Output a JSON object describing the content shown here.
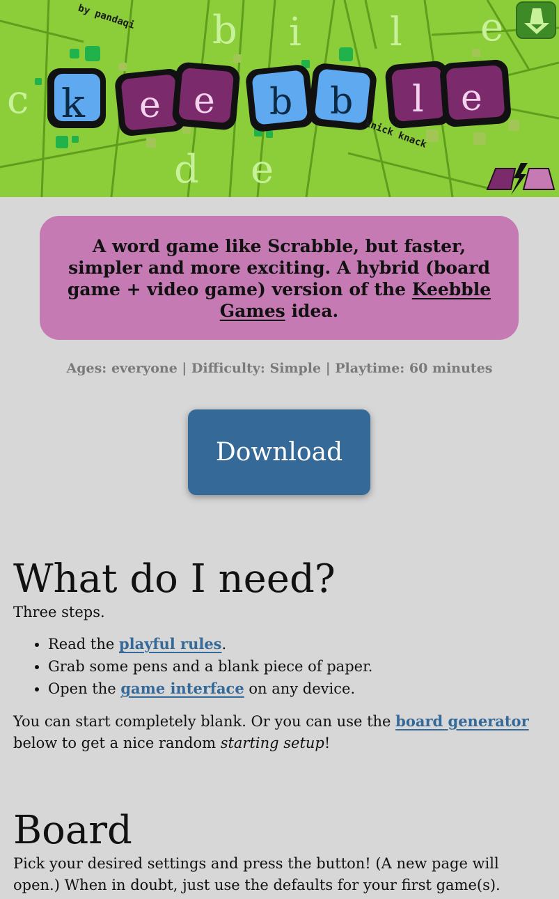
{
  "header": {
    "logo_letters": [
      "k",
      "e",
      "e",
      "b",
      "b",
      "l",
      "e"
    ],
    "byline": "by pandaqi",
    "series": "knick knack",
    "background_letters": [
      "c",
      "b",
      "i",
      "l",
      "e",
      "d",
      "e"
    ],
    "home_icon": "home-cone-icon",
    "brand_icon": "pandaqi-logo-icon",
    "colors": {
      "green": "#8ccd3a",
      "blue_tile": "#5ea9ef",
      "purple_tile": "#7b2a6b"
    }
  },
  "intro": {
    "text_before": "A word game like Scrabble, but faster, simpler and more exciting. A hybrid (board game + video game) version of the ",
    "link": "Keebble Games",
    "text_after": " idea."
  },
  "meta": "Ages: everyone | Difficulty: Simple | Playtime: 60 minutes",
  "download_label": "Download",
  "section_need": {
    "title": "What do I need?",
    "subtitle": "Three steps.",
    "items": [
      {
        "before": "Read the ",
        "link": "playful rules",
        "after": "."
      },
      {
        "before": "Grab some pens and a blank piece of paper.",
        "link": "",
        "after": ""
      },
      {
        "before": "Open the ",
        "link": "game interface",
        "after": " on any device."
      }
    ],
    "para_before": "You can start completely blank. Or you can use the ",
    "para_link": "board generator",
    "para_mid": " below to get a nice random ",
    "para_em": "starting setup",
    "para_after": "!"
  },
  "section_board": {
    "title": "Board",
    "text": "Pick your desired settings and press the button! (A new page will open.) When in doubt, just use the defaults for your first game(s)."
  }
}
